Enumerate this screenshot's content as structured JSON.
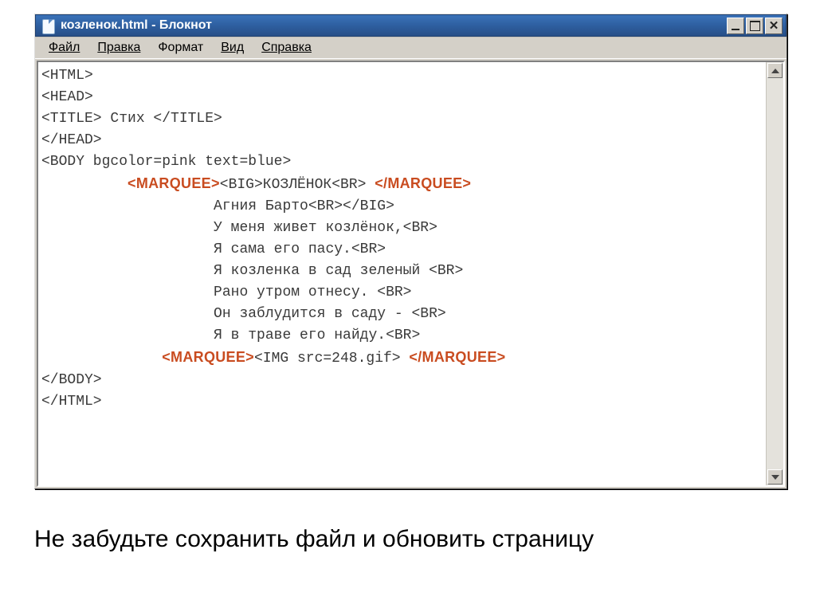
{
  "window": {
    "title": "козленок.html - Блокнот",
    "minimize_tip": "Свернуть",
    "maximize_tip": "Развернуть",
    "close_tip": "Закрыть"
  },
  "menu": {
    "file": "Файл",
    "edit": "Правка",
    "format": "Формат",
    "view": "Вид",
    "help": "Справка"
  },
  "mq": {
    "open": "<MARQUEE>",
    "close": "</MARQUEE>"
  },
  "code": {
    "l01": "<HTML>",
    "l02": "<HEAD>",
    "l03": "<TITLE> Стих </TITLE>",
    "l04": "</HEAD>",
    "l05": "<BODY bgcolor=pink text=blue>",
    "l06_pre": "          ",
    "l06_mid": "<BIG>КОЗЛЁНОК<BR>",
    "l07": "                    Агния Барто<BR></BIG>",
    "l08": "                    У меня живет козлёнок,<BR>",
    "l09": "                    Я сама его пасу.<BR>",
    "l10": "                    Я козленка в сад зеленый <BR>",
    "l11": "                    Рано утром отнесу. <BR>",
    "l12": "                    Он заблудится в саду - <BR>",
    "l13": "                    Я в траве его найду.<BR>",
    "l14_pre": "              ",
    "l14_mid": "<IMG src=248.gif>",
    "l15": "</BODY>",
    "l16": "</HTML>"
  },
  "caption": "Не забудьте сохранить файл и обновить страницу"
}
